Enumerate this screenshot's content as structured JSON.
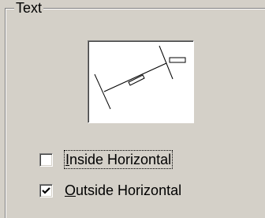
{
  "group": {
    "title": "Text"
  },
  "preview": {
    "icon": "dimension-text-outside-horizontal-preview"
  },
  "options": [
    {
      "mnemonic": "I",
      "rest": "nside Horizontal",
      "checked": false,
      "focused": true
    },
    {
      "mnemonic": "O",
      "rest": "utside Horizontal",
      "checked": true,
      "focused": false
    }
  ]
}
